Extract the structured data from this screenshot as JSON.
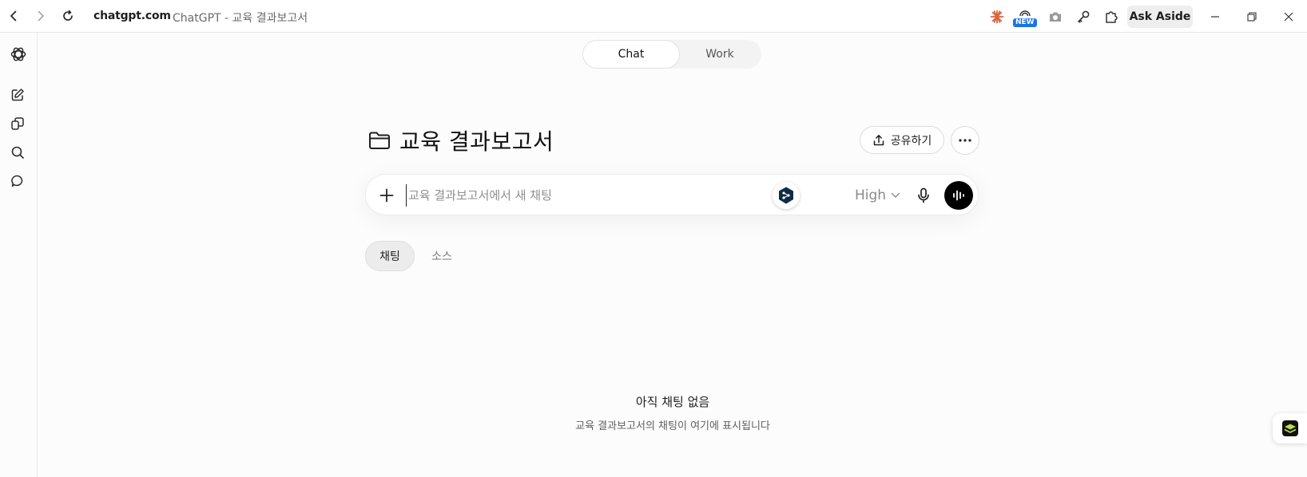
{
  "browser": {
    "url": "chatgpt.com",
    "tab_title": "ChatGPT - 교육 결과보고서",
    "new_badge": "NEW",
    "ask_aside_label": "Ask Aside"
  },
  "mode_toggle": {
    "tabs": [
      {
        "label": "Chat",
        "active": true
      },
      {
        "label": "Work",
        "active": false
      }
    ]
  },
  "project": {
    "title": "교육 결과보고서",
    "share_label": "공유하기"
  },
  "composer": {
    "placeholder": "교육 결과보고서에서 새 채팅",
    "model": "High"
  },
  "content_tabs": [
    {
      "label": "채팅",
      "active": true
    },
    {
      "label": "소스",
      "active": false
    }
  ],
  "empty_state": {
    "title": "아직 채팅 없음",
    "subtitle": "교육 결과보고서의 채팅이 여기에 표시됩니다"
  },
  "colors": {
    "accent_new": "#1a73e8",
    "voice_button": "#000000",
    "page_bg": "#fcfcfc"
  }
}
